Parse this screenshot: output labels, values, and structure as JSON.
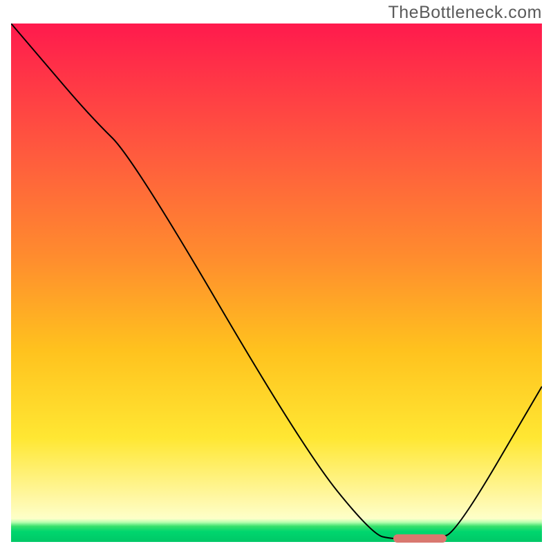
{
  "watermark": "TheBottleneck.com",
  "chart_data": {
    "type": "line",
    "title": "",
    "xlabel": "",
    "ylabel": "",
    "xlim": [
      0,
      100
    ],
    "ylim": [
      0,
      100
    ],
    "grid": false,
    "legend": false,
    "background_gradient_stops": [
      {
        "pct": 0,
        "color": "#ff1a4d"
      },
      {
        "pct": 8,
        "color": "#ff2f48"
      },
      {
        "pct": 25,
        "color": "#ff5a3e"
      },
      {
        "pct": 45,
        "color": "#ff8c2e"
      },
      {
        "pct": 63,
        "color": "#ffc21e"
      },
      {
        "pct": 80,
        "color": "#ffe733"
      },
      {
        "pct": 92,
        "color": "#fff8a8"
      },
      {
        "pct": 95.5,
        "color": "#fdffc9"
      },
      {
        "pct": 96.2,
        "color": "#b8ffb0"
      },
      {
        "pct": 97,
        "color": "#35e06b"
      },
      {
        "pct": 98,
        "color": "#00d66e"
      },
      {
        "pct": 100,
        "color": "#00c867"
      }
    ],
    "series": [
      {
        "name": "bottleneck-curve",
        "color": "#000000",
        "stroke_width": 2,
        "x": [
          0,
          5,
          15,
          23,
          55,
          68,
          72,
          80,
          84,
          100
        ],
        "y": [
          100,
          94,
          82,
          74,
          18,
          1.5,
          0.5,
          0.5,
          2,
          30
        ]
      }
    ],
    "markers": [
      {
        "name": "optimal-range",
        "color": "#d9786f",
        "x_start": 72,
        "x_end": 82,
        "y": 0.7
      }
    ]
  }
}
